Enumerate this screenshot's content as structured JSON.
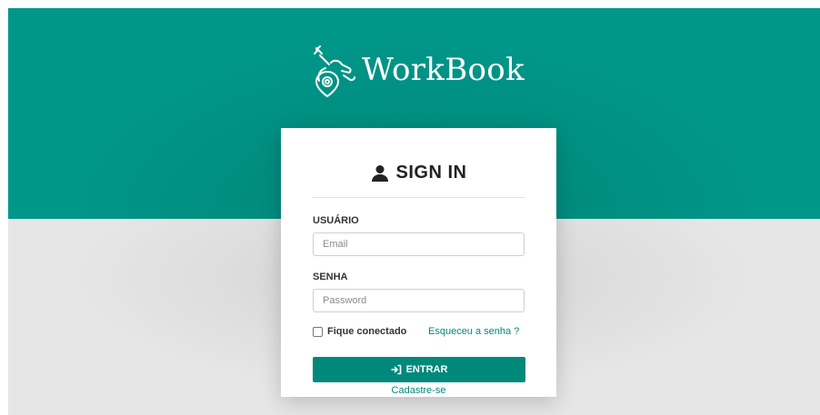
{
  "brand": {
    "name": "WorkBook",
    "logo_icon": "wrench-hand-location-icon"
  },
  "colors": {
    "primary": "#009688",
    "button": "#00897b",
    "link": "#00897b",
    "background": "#e6e6e6"
  },
  "card": {
    "title": "SIGN IN",
    "title_icon": "user-icon",
    "username": {
      "label": "USUÁRIO",
      "placeholder": "Email",
      "value": ""
    },
    "password": {
      "label": "SENHA",
      "placeholder": "Password",
      "value": ""
    },
    "remember_label": "Fique conectado",
    "remember_checked": false,
    "forgot_link": "Esqueceu a senha ?",
    "submit_label": "ENTRAR",
    "submit_icon": "sign-in-icon",
    "signup_link": "Cadastre-se"
  }
}
